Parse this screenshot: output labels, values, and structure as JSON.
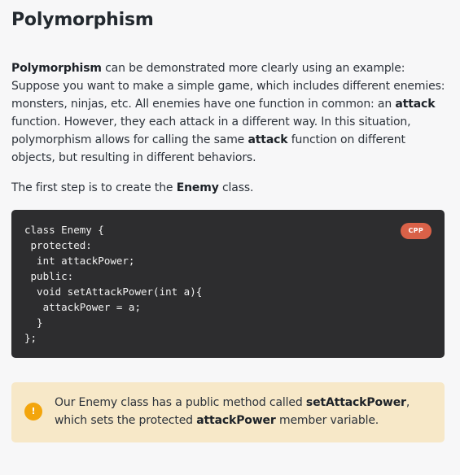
{
  "lesson": {
    "title": "Polymorphism",
    "intro": {
      "term": "Polymorphism",
      "part1": " can be demonstrated more clearly using an example: Suppose you want to make a simple game, which includes different enemies: monsters, ninjas, etc. All enemies have one function in common: an ",
      "kw_attack_1": "attack",
      "part2": " function. However, they each attack in a different way. In this situation, polymorphism allows for calling the same ",
      "kw_attack_2": "attack",
      "part3": " function on different objects, but resulting in different behaviors."
    },
    "step": {
      "before": "The first step is to create the ",
      "class_name": "Enemy",
      "after": " class."
    }
  },
  "code": {
    "language_badge": "CPP",
    "text": "class Enemy {\n protected:\n  int attackPower;\n public:\n  void setAttackPower(int a){\n   attackPower = a;\n  }\n};"
  },
  "note": {
    "icon": "exclamation-icon",
    "icon_glyph": "!",
    "before": "Our Enemy class has a public method called ",
    "method": "setAttackPower",
    "middle": ", which sets the protected ",
    "member": "attackPower",
    "after": " member variable."
  },
  "colors": {
    "background": "#f7f7f8",
    "code_background": "#2d2d2f",
    "badge": "#d96148",
    "note_background": "#f7e8c8",
    "note_icon": "#f3a50c"
  }
}
